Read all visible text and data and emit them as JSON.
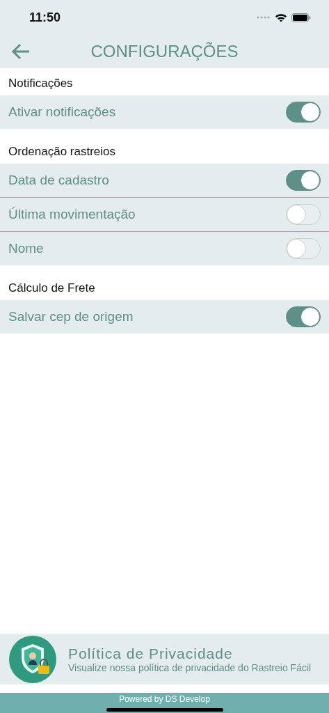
{
  "status_bar": {
    "time": "11:50"
  },
  "header": {
    "title": "CONFIGURAÇÕES"
  },
  "sections": [
    {
      "title": "Notificações",
      "items": [
        {
          "label": "Ativar notificações",
          "on": true
        }
      ]
    },
    {
      "title": "Ordenação rastreios",
      "items": [
        {
          "label": "Data de cadastro",
          "on": true
        },
        {
          "label": "Última movimentação",
          "on": false
        },
        {
          "label": "Nome",
          "on": false
        }
      ]
    },
    {
      "title": "Cálculo de Frete",
      "items": [
        {
          "label": "Salvar cep de origem",
          "on": true
        }
      ]
    }
  ],
  "privacy": {
    "title": "Política de Privacidade",
    "description": "Visualize nossa política de privacidade do Rastreio Fácil"
  },
  "footer": {
    "text": "Powered by DS Develop"
  }
}
